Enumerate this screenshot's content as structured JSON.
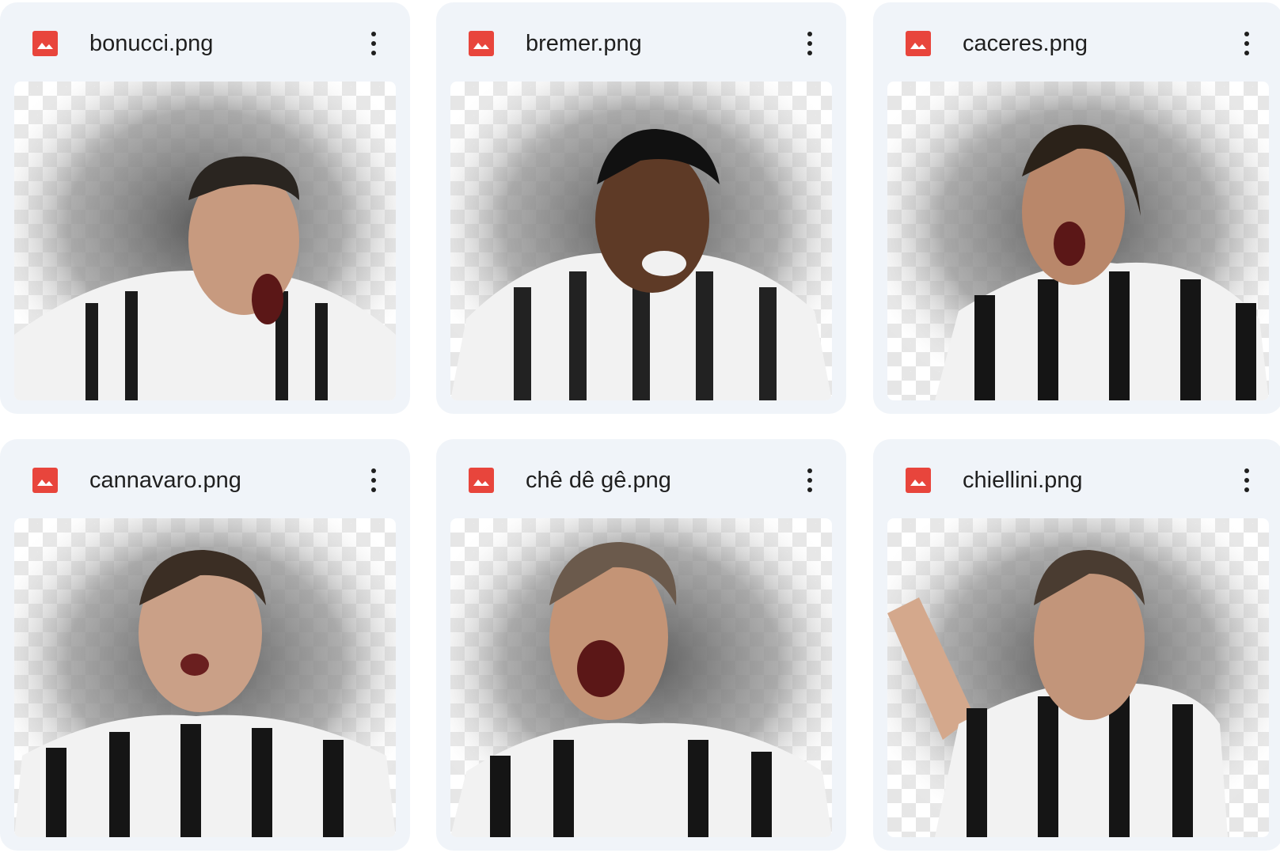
{
  "files": [
    {
      "name": "bonucci.png",
      "icon": "image-icon",
      "accent": "#e8453c"
    },
    {
      "name": "bremer.png",
      "icon": "image-icon",
      "accent": "#e8453c"
    },
    {
      "name": "caceres.png",
      "icon": "image-icon",
      "accent": "#e8453c"
    },
    {
      "name": "cannavaro.png",
      "icon": "image-icon",
      "accent": "#e8453c"
    },
    {
      "name": "chê dê gê.png",
      "icon": "image-icon",
      "accent": "#e8453c"
    },
    {
      "name": "chiellini.png",
      "icon": "image-icon",
      "accent": "#e8453c"
    }
  ]
}
